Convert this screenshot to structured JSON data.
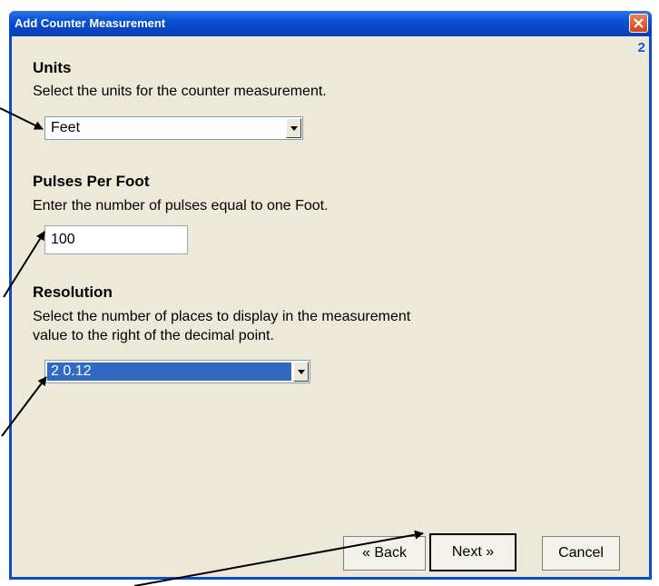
{
  "window": {
    "title": "Add Counter Measurement",
    "step": "2"
  },
  "units": {
    "heading": "Units",
    "description": "Select the units for the counter measurement.",
    "selected": "Feet"
  },
  "pulses": {
    "heading": "Pulses Per Foot",
    "description": "Enter the number of pulses equal to one Foot.",
    "value": "100"
  },
  "resolution": {
    "heading": "Resolution",
    "description_line1": "Select the number of places to display in the measurement",
    "description_line2": "value to the right of the decimal point.",
    "selected": "2   0.12"
  },
  "buttons": {
    "back": "« Back",
    "next": "Next »",
    "cancel": "Cancel"
  },
  "colors": {
    "titlebar": "#0a55d8",
    "client_bg": "#ece9d8",
    "selection": "#316ac5"
  }
}
